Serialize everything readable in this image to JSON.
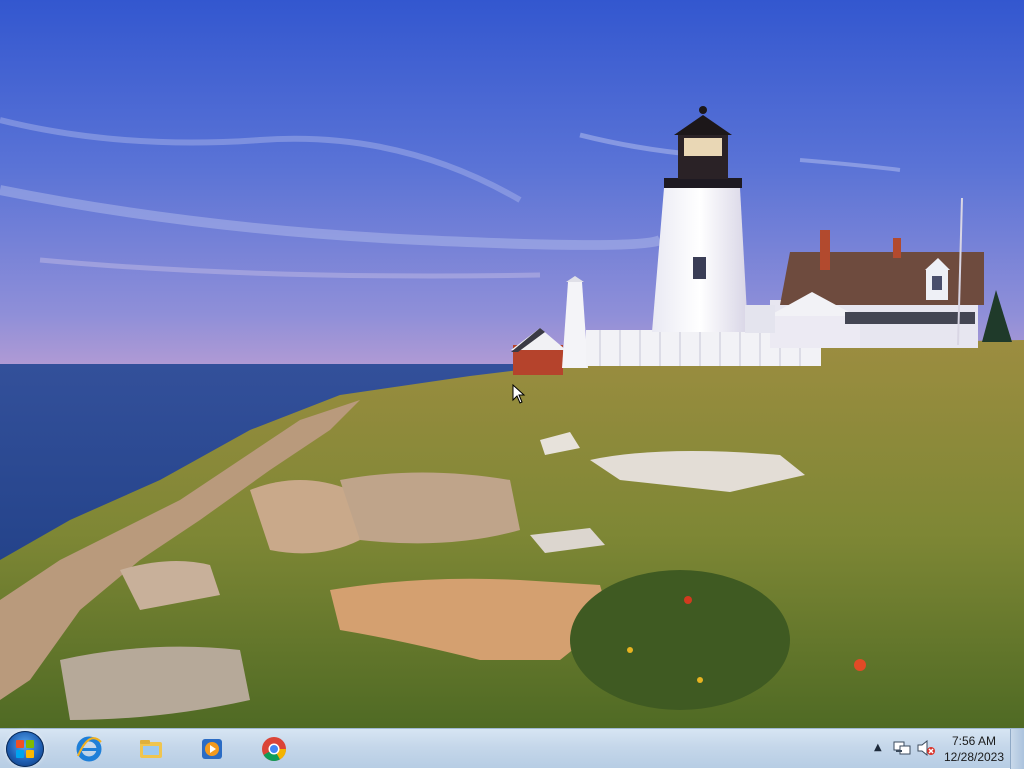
{
  "desktop": {
    "wallpaper": "lighthouse-coast"
  },
  "taskbar": {
    "start_icon": "windows-start-orb",
    "pinned_apps": [
      {
        "name": "internet-explorer",
        "icon": "internet-explorer-icon"
      },
      {
        "name": "windows-explorer",
        "icon": "folder-icon"
      },
      {
        "name": "windows-media-player",
        "icon": "media-player-icon"
      },
      {
        "name": "google-chrome",
        "icon": "chrome-icon"
      }
    ],
    "tray": {
      "show_hidden_icon": "▲",
      "network_icon": "network-icon",
      "volume_icon": "volume-muted-icon"
    },
    "clock": {
      "time": "7:56 AM",
      "date": "12/28/2023"
    }
  },
  "colors": {
    "taskbar": "#c5d7ea",
    "sky_top": "#3a5fd0",
    "sea": "#2f4f9a",
    "grass": "#8a8a3a"
  }
}
